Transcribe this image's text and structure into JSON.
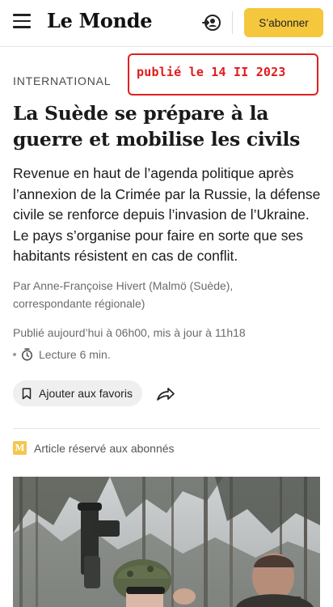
{
  "header": {
    "logo": "Le Monde",
    "subscribe_label": "S’abonner"
  },
  "stamp": "publié le 14 II 2023",
  "article": {
    "rubric": "INTERNATIONAL",
    "title": "La Suède se prépare à la guerre et mobilise les civils",
    "lede": "Revenue en haut de l’agenda politique après l’annexion de la Crimée par la Russie, la défense civile se renforce depuis l’invasion de l’Ukraine. Le pays s’organise pour faire en sorte que ses habitants résistent en cas de conflit.",
    "byline": "Par Anne-Françoise Hivert (Malmö (Suède), correspondante régionale)",
    "date": "Publié aujourd’hui à 06h00, mis à jour à 11h18",
    "read_time": "Lecture 6 min.",
    "favorite_label": "Ajouter aux favoris",
    "subscriber_label": "Article réservé aux abonnés",
    "subscriber_badge": "M"
  },
  "icons": {
    "menu": "hamburger-icon",
    "account": "account-icon",
    "clock": "clock-icon",
    "bookmark": "bookmark-icon",
    "share": "share-icon"
  },
  "colors": {
    "subscribe": "#f5c73d",
    "stamp": "#e02020",
    "badge": "#f3c74e"
  }
}
